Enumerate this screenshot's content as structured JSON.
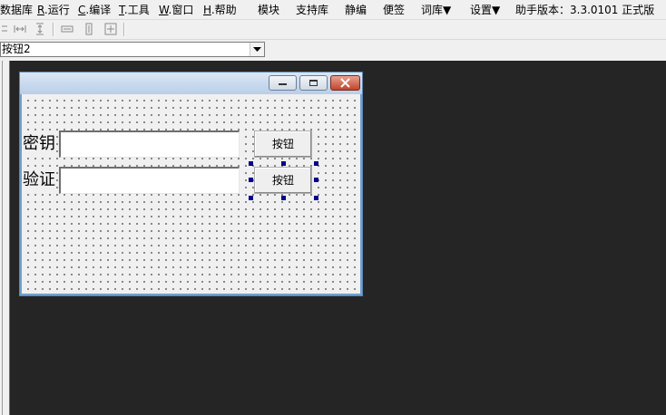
{
  "menubar": {
    "items": [
      {
        "accel": "",
        "label": "数据库"
      },
      {
        "accel": "R",
        "label": ".运行"
      },
      {
        "accel": "C",
        "label": ".编译"
      },
      {
        "accel": "T",
        "label": ".工具"
      },
      {
        "accel": "W",
        "label": ".窗口"
      },
      {
        "accel": "H",
        "label": ".帮助"
      },
      {
        "accel": "",
        "label": "模块"
      },
      {
        "accel": "",
        "label": "支持库"
      },
      {
        "accel": "",
        "label": "静编"
      },
      {
        "accel": "",
        "label": "便签"
      },
      {
        "accel": "",
        "label": "词库▼"
      },
      {
        "accel": "",
        "label": "设置▼"
      },
      {
        "accel": "",
        "label": "助手版本：3.3.0101 正式版"
      }
    ]
  },
  "toolbar": {
    "icons": [
      "align-left-icon",
      "space-horizontal-icon",
      "space-vertical-icon",
      "same-width-icon",
      "same-height-icon",
      "same-size-icon"
    ]
  },
  "component_selector": {
    "selected": "按钮2"
  },
  "design_window": {
    "fields": [
      {
        "label": "密钥",
        "value": "",
        "button": "按钮"
      },
      {
        "label": "验证",
        "value": "",
        "button": "按钮"
      }
    ]
  },
  "colors": {
    "workspace_bg": "#252525",
    "selection_handle": "#00008b",
    "window_border": "#6fa0cf"
  }
}
